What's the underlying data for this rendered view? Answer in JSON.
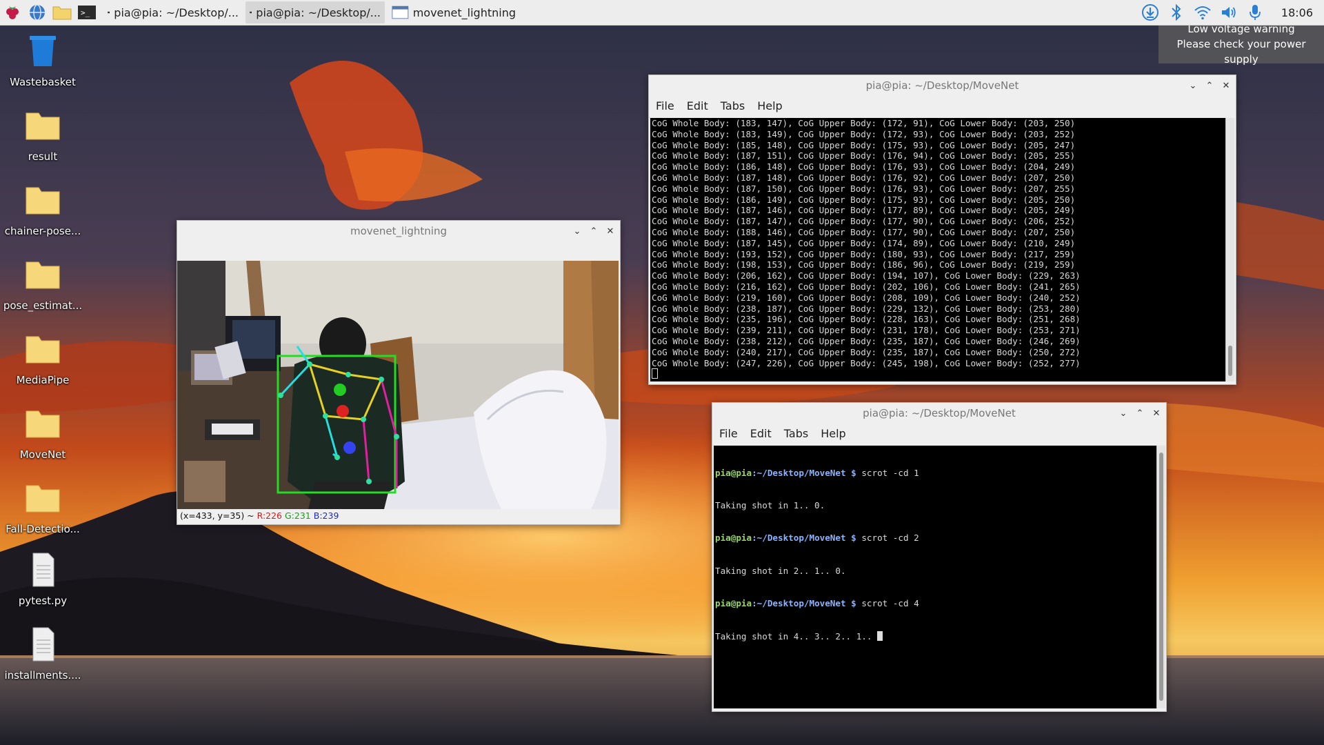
{
  "taskbar": {
    "tasks": [
      {
        "label": "pia@pia: ~/Desktop/..."
      },
      {
        "label": "pia@pia: ~/Desktop/..."
      },
      {
        "label": "movenet_lightning"
      }
    ],
    "clock": "18:06"
  },
  "notification": {
    "line1": "Low voltage warning",
    "line2": "Please check your power supply"
  },
  "desktop_icons": [
    {
      "label": "Wastebasket",
      "icon": "trash-icon"
    },
    {
      "label": "result",
      "icon": "folder-icon"
    },
    {
      "label": "chainer-pose...",
      "icon": "folder-icon"
    },
    {
      "label": "pose_estimat...",
      "icon": "folder-icon"
    },
    {
      "label": "MediaPipe",
      "icon": "folder-icon"
    },
    {
      "label": "MoveNet",
      "icon": "folder-icon"
    },
    {
      "label": "Fall-Detectio...",
      "icon": "folder-icon"
    },
    {
      "label": "pytest.py",
      "icon": "file-icon"
    },
    {
      "label": "installments....",
      "icon": "file-icon"
    }
  ],
  "movenet_window": {
    "title": "movenet_lightning",
    "status": {
      "coords": "(x=433, y=35) ~",
      "r": "R:226",
      "g": "G:231",
      "b": "B:239"
    }
  },
  "term_top": {
    "title": "pia@pia: ~/Desktop/MoveNet",
    "menu": [
      "File",
      "Edit",
      "Tabs",
      "Help"
    ],
    "lines": [
      "CoG Whole Body: (183, 147), CoG Upper Body: (172, 91), CoG Lower Body: (203, 250)",
      "CoG Whole Body: (183, 149), CoG Upper Body: (172, 93), CoG Lower Body: (203, 252)",
      "CoG Whole Body: (185, 148), CoG Upper Body: (175, 93), CoG Lower Body: (205, 247)",
      "CoG Whole Body: (187, 151), CoG Upper Body: (176, 94), CoG Lower Body: (205, 255)",
      "CoG Whole Body: (186, 148), CoG Upper Body: (176, 93), CoG Lower Body: (204, 249)",
      "CoG Whole Body: (187, 148), CoG Upper Body: (176, 92), CoG Lower Body: (207, 250)",
      "CoG Whole Body: (187, 150), CoG Upper Body: (176, 93), CoG Lower Body: (207, 255)",
      "CoG Whole Body: (186, 149), CoG Upper Body: (175, 93), CoG Lower Body: (205, 250)",
      "CoG Whole Body: (187, 146), CoG Upper Body: (177, 89), CoG Lower Body: (205, 249)",
      "CoG Whole Body: (187, 147), CoG Upper Body: (177, 90), CoG Lower Body: (206, 252)",
      "CoG Whole Body: (188, 146), CoG Upper Body: (177, 90), CoG Lower Body: (207, 250)",
      "CoG Whole Body: (187, 145), CoG Upper Body: (174, 89), CoG Lower Body: (210, 249)",
      "CoG Whole Body: (193, 152), CoG Upper Body: (180, 93), CoG Lower Body: (217, 259)",
      "CoG Whole Body: (198, 153), CoG Upper Body: (186, 96), CoG Lower Body: (219, 259)",
      "CoG Whole Body: (206, 162), CoG Upper Body: (194, 107), CoG Lower Body: (229, 263)",
      "CoG Whole Body: (216, 162), CoG Upper Body: (202, 106), CoG Lower Body: (241, 265)",
      "CoG Whole Body: (219, 160), CoG Upper Body: (208, 109), CoG Lower Body: (240, 252)",
      "CoG Whole Body: (238, 187), CoG Upper Body: (229, 132), CoG Lower Body: (253, 280)",
      "CoG Whole Body: (235, 196), CoG Upper Body: (228, 163), CoG Lower Body: (251, 268)",
      "CoG Whole Body: (239, 211), CoG Upper Body: (231, 178), CoG Lower Body: (253, 271)",
      "CoG Whole Body: (238, 212), CoG Upper Body: (235, 187), CoG Lower Body: (246, 269)",
      "CoG Whole Body: (240, 217), CoG Upper Body: (235, 187), CoG Lower Body: (250, 272)",
      "CoG Whole Body: (247, 226), CoG Upper Body: (245, 198), CoG Lower Body: (252, 277)"
    ]
  },
  "term_bottom": {
    "title": "pia@pia: ~/Desktop/MoveNet",
    "menu": [
      "File",
      "Edit",
      "Tabs",
      "Help"
    ],
    "prompt_user": "pia@pia",
    "prompt_path": ":~/Desktop/MoveNet $",
    "sessions": [
      {
        "cmd": " scrot -cd 1",
        "out": "Taking shot in 1.. 0."
      },
      {
        "cmd": " scrot -cd 2",
        "out": "Taking shot in 2.. 1.. 0."
      },
      {
        "cmd": " scrot -cd 4",
        "out": "Taking shot in 4.. 3.. 2.. 1.. "
      }
    ]
  },
  "colors": {
    "skeleton_box": "#22dd22",
    "skeleton_left": "#22e0e0",
    "skeleton_right": "#e020a0",
    "skeleton_torso": "#e8d020",
    "cog_whole": "#22cc22",
    "cog_upper": "#dd2222",
    "cog_lower": "#3344ee"
  }
}
